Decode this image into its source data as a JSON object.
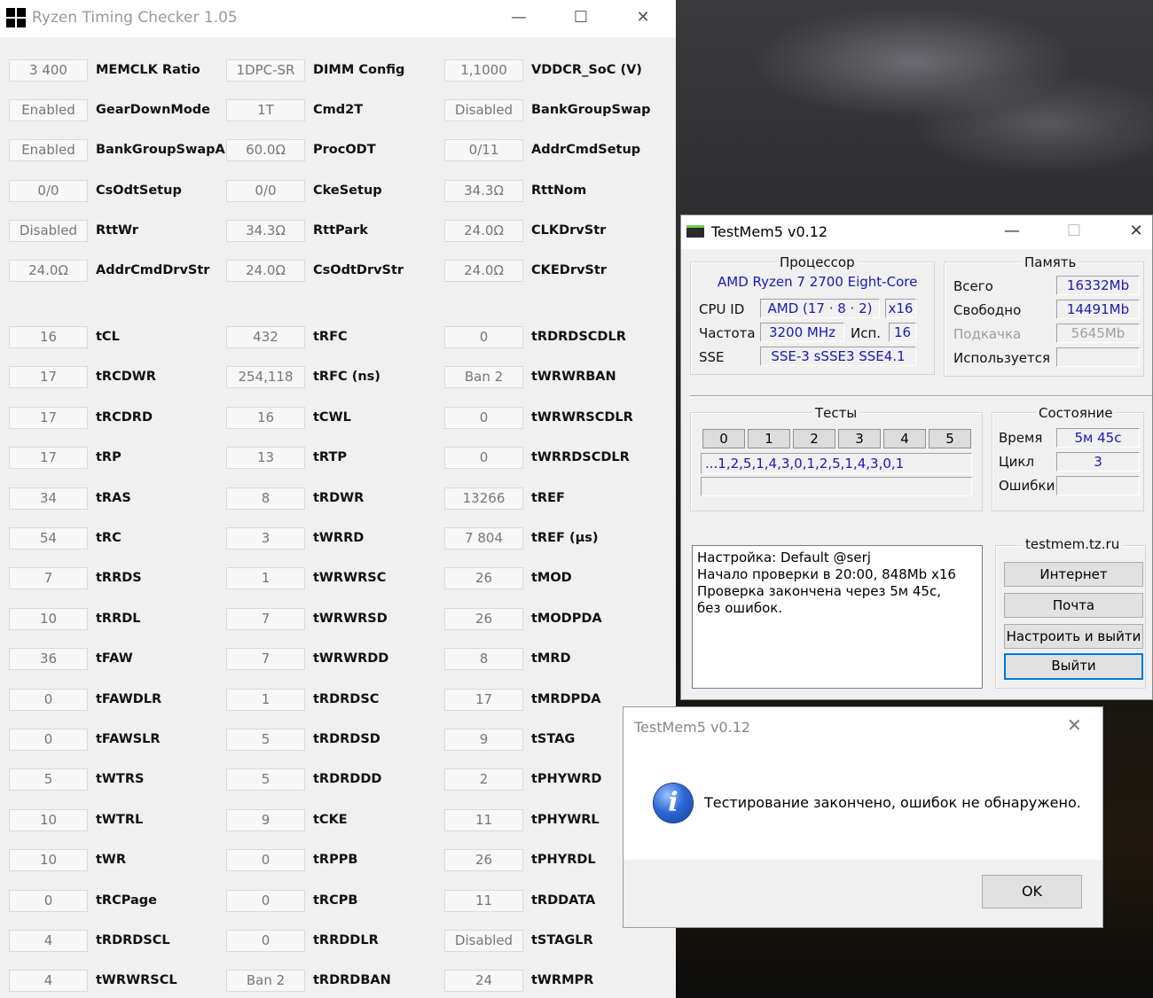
{
  "rtc": {
    "title": "Ryzen Timing Checker 1.05",
    "min_glyph": "—",
    "max_glyph": "☐",
    "close_glyph": "✕",
    "col1": [
      {
        "value": "3 400",
        "label": "MEMCLK Ratio"
      },
      {
        "value": "Enabled",
        "label": "GearDownMode"
      },
      {
        "value": "Enabled",
        "label": "BankGroupSwapAlt"
      },
      {
        "value": "0/0",
        "label": "CsOdtSetup"
      },
      {
        "value": "Disabled",
        "label": "RttWr"
      },
      {
        "value": "24.0Ω",
        "label": "AddrCmdDrvStr"
      },
      {
        "value": "16",
        "label": "tCL"
      },
      {
        "value": "17",
        "label": "tRCDWR"
      },
      {
        "value": "17",
        "label": "tRCDRD"
      },
      {
        "value": "17",
        "label": "tRP"
      },
      {
        "value": "34",
        "label": "tRAS"
      },
      {
        "value": "54",
        "label": "tRC"
      },
      {
        "value": "7",
        "label": "tRRDS"
      },
      {
        "value": "10",
        "label": "tRRDL"
      },
      {
        "value": "36",
        "label": "tFAW"
      },
      {
        "value": "0",
        "label": "tFAWDLR"
      },
      {
        "value": "0",
        "label": "tFAWSLR"
      },
      {
        "value": "5",
        "label": "tWTRS"
      },
      {
        "value": "10",
        "label": "tWTRL"
      },
      {
        "value": "10",
        "label": "tWR"
      },
      {
        "value": "0",
        "label": "tRCPage"
      },
      {
        "value": "4",
        "label": "tRDRDSCL"
      },
      {
        "value": "4",
        "label": "tWRWRSCL"
      }
    ],
    "col2": [
      {
        "value": "1DPC-SR",
        "label": "DIMM Config"
      },
      {
        "value": "1T",
        "label": "Cmd2T"
      },
      {
        "value": "60.0Ω",
        "label": "ProcODT"
      },
      {
        "value": "0/0",
        "label": "CkeSetup"
      },
      {
        "value": "34.3Ω",
        "label": "RttPark"
      },
      {
        "value": "24.0Ω",
        "label": "CsOdtDrvStr"
      },
      {
        "value": "432",
        "label": "tRFC"
      },
      {
        "value": "254,118",
        "label": "tRFC (ns)"
      },
      {
        "value": "16",
        "label": "tCWL"
      },
      {
        "value": "13",
        "label": "tRTP"
      },
      {
        "value": "8",
        "label": "tRDWR"
      },
      {
        "value": "3",
        "label": "tWRRD"
      },
      {
        "value": "1",
        "label": "tWRWRSC"
      },
      {
        "value": "7",
        "label": "tWRWRSD"
      },
      {
        "value": "7",
        "label": "tWRWRDD"
      },
      {
        "value": "1",
        "label": "tRDRDSC"
      },
      {
        "value": "5",
        "label": "tRDRDSD"
      },
      {
        "value": "5",
        "label": "tRDRDDD"
      },
      {
        "value": "9",
        "label": "tCKE"
      },
      {
        "value": "0",
        "label": "tRPPB"
      },
      {
        "value": "0",
        "label": "tRCPB"
      },
      {
        "value": "0",
        "label": "tRRDDLR"
      },
      {
        "value": "Ban 2",
        "label": "tRDRDBAN"
      }
    ],
    "col3": [
      {
        "value": "1,1000",
        "label": "VDDCR_SoC (V)"
      },
      {
        "value": "Disabled",
        "label": "BankGroupSwap"
      },
      {
        "value": "0/11",
        "label": "AddrCmdSetup"
      },
      {
        "value": "34.3Ω",
        "label": "RttNom"
      },
      {
        "value": "24.0Ω",
        "label": "CLKDrvStr"
      },
      {
        "value": "24.0Ω",
        "label": "CKEDrvStr"
      },
      {
        "value": "0",
        "label": "tRDRDSCDLR"
      },
      {
        "value": "Ban 2",
        "label": "tWRWRBAN"
      },
      {
        "value": "0",
        "label": "tWRWRSCDLR"
      },
      {
        "value": "0",
        "label": "tWRRDSCDLR"
      },
      {
        "value": "13266",
        "label": "tREF"
      },
      {
        "value": "7 804",
        "label": "tREF (μs)"
      },
      {
        "value": "26",
        "label": "tMOD"
      },
      {
        "value": "26",
        "label": "tMODPDA"
      },
      {
        "value": "8",
        "label": "tMRD"
      },
      {
        "value": "17",
        "label": "tMRDPDA"
      },
      {
        "value": "9",
        "label": "tSTAG"
      },
      {
        "value": "2",
        "label": "tPHYWRD"
      },
      {
        "value": "11",
        "label": "tPHYWRL"
      },
      {
        "value": "26",
        "label": "tPHYRDL"
      },
      {
        "value": "11",
        "label": "tRDDATA"
      },
      {
        "value": "Disabled",
        "label": "tSTAGLR"
      },
      {
        "value": "24",
        "label": "tWRMPR"
      }
    ]
  },
  "testmem": {
    "title": "TestMem5 v0.12",
    "min_glyph": "—",
    "max_glyph": "☐",
    "close_glyph": "✕",
    "cpu": {
      "group_title": "Процессор",
      "name": "AMD Ryzen 7 2700 Eight-Core",
      "cpuid_label": "CPU ID",
      "cpuid_value": "AMD  (17 · 8 · 2)",
      "cpuid_threads": "x16",
      "freq_label": "Частота",
      "freq_value": "3200 MHz",
      "used_label": "Исп.",
      "used_value": "16",
      "sse_label": "SSE",
      "sse_value": "SSE-3 sSSE3 SSE4.1"
    },
    "memory": {
      "group_title": "Память",
      "total_label": "Всего",
      "total_value": "16332Mb",
      "free_label": "Свободно",
      "free_value": "14491Mb",
      "swap_label": "Подкачка",
      "swap_value": "5645Mb",
      "used_label": "Используется",
      "used_value": ""
    },
    "tests": {
      "group_title": "Тесты",
      "numbers": [
        "0",
        "1",
        "2",
        "3",
        "4",
        "5"
      ],
      "sequence": "...1,2,5,1,4,3,0,1,2,5,1,4,3,0,1",
      "extra": ""
    },
    "status": {
      "group_title": "Состояние",
      "time_label": "Время",
      "time_value": "5м 45с",
      "cycle_label": "Цикл",
      "cycle_value": "3",
      "errors_label": "Ошибки",
      "errors_value": ""
    },
    "log_lines": [
      "Настройка: Default @serj",
      "Начало проверки в 20:00, 848Mb x16",
      "Проверка закончена через 5м 45с,",
      "без ошибок."
    ],
    "site": {
      "group_title": "testmem.tz.ru",
      "internet": "Интернет",
      "mail": "Почта",
      "configure_exit": "Настроить и выйти",
      "exit": "Выйти"
    }
  },
  "dialog": {
    "title": "TestMem5 v0.12",
    "close_glyph": "✕",
    "icon_glyph": "i",
    "message": "Тестирование закончено, ошибок не обнаружено.",
    "ok": "OK"
  }
}
